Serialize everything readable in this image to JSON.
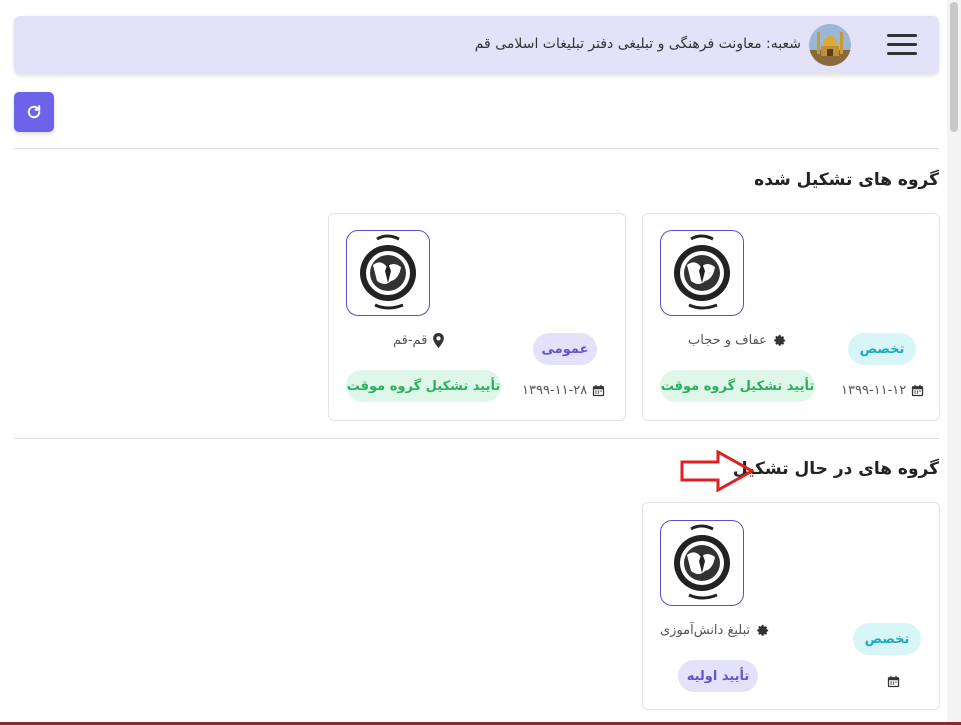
{
  "header": {
    "menu_icon": "hamburger-icon",
    "avatar_alt": "shrine-avatar",
    "branch_text": "شعبه: معاونت فرهنگی و تبلیغی دفتر تبلیغات اسلامی قم"
  },
  "toolbar": {
    "refresh_icon": "refresh-icon"
  },
  "sections": {
    "formed": {
      "title": "گروه های تشکیل شده",
      "cards": [
        {
          "type_badge": "تخصص",
          "topic": "عفاف و حجاب",
          "date": "۱۳۹۹-۱۱-۱۲",
          "status": "تأیید تشکیل گروه موقت"
        },
        {
          "type_badge": "عمومی",
          "topic": "قم-قم",
          "date": "۱۳۹۹-۱۱-۲۸",
          "status": "تأیید تشکیل گروه موقت"
        }
      ]
    },
    "forming": {
      "title": "گروه های در حال تشکیل",
      "cards": [
        {
          "type_badge": "تخصص",
          "topic": "تبلیغ دانش‌آموزی",
          "date": "",
          "status": "تأیید اولیه"
        }
      ]
    }
  },
  "colors": {
    "accent": "#6c63e8",
    "header_bg": "#e3e2f9",
    "arrow": "#e02020"
  }
}
